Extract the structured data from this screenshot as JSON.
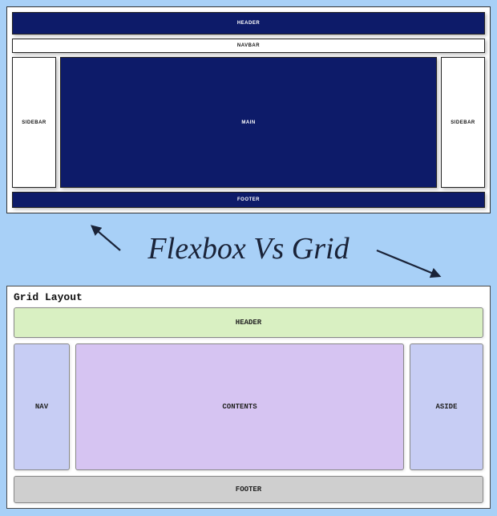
{
  "title": "Flexbox Vs Grid",
  "flex": {
    "header": "HEADER",
    "navbar": "NAVBAR",
    "sidebar_left": "SIDEBAR",
    "main": "MAIN",
    "sidebar_right": "SIDEBAR",
    "footer": "FOOTER"
  },
  "grid": {
    "title": "Grid Layout",
    "header": "HEADER",
    "nav": "NAV",
    "contents": "CONTENTS",
    "aside": "ASIDE",
    "footer": "FOOTER"
  },
  "colors": {
    "page_bg": "#a8d0f7",
    "flex_dark": "#0d1b69",
    "grid_header": "#d9f0c2",
    "grid_nav": "#c7cdf4",
    "grid_contents": "#d6c4f2",
    "grid_aside": "#c7cdf4",
    "grid_footer": "#cfcfcf"
  }
}
